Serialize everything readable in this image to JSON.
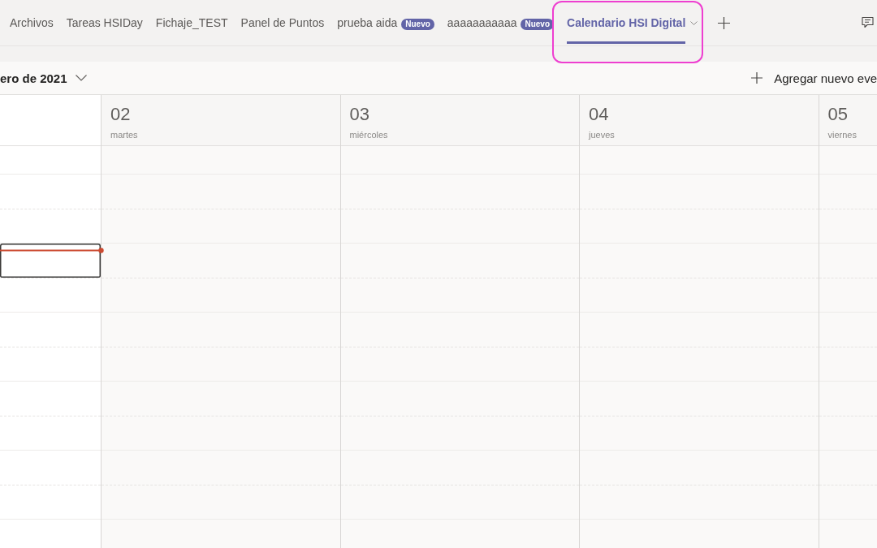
{
  "tab_bar": {
    "tabs": [
      {
        "label": "Archivos",
        "selected": false,
        "has_menu": false,
        "highlighted": false
      },
      {
        "label": "Tareas HSIDay",
        "selected": false,
        "has_menu": false,
        "highlighted": false
      },
      {
        "label": "Fichaje_TEST",
        "selected": false,
        "has_menu": false,
        "highlighted": false
      },
      {
        "label": "Panel de Puntos",
        "selected": false,
        "has_menu": false,
        "highlighted": false
      },
      {
        "label": "prueba aida",
        "badge": "Nuevo",
        "selected": false,
        "has_menu": false,
        "highlighted": false
      },
      {
        "label": "aaaaaaaaaaa",
        "badge": "Nuevo",
        "selected": false,
        "has_menu": false,
        "highlighted": false
      },
      {
        "label": "Calendario HSI Digital",
        "selected": true,
        "has_menu": true,
        "highlighted": true
      }
    ]
  },
  "toolbar": {
    "month": "ero de 2021",
    "add_event": "Agregar nuevo eve"
  },
  "calendar": {
    "days": [
      {
        "number": "02",
        "name": "martes"
      },
      {
        "number": "03",
        "name": "miércoles"
      },
      {
        "number": "04",
        "name": "jueves"
      },
      {
        "number": "05",
        "name": "viernes"
      }
    ],
    "time_slots": [
      {
        "selected": false,
        "now": false
      },
      {
        "selected": false,
        "now": false
      },
      {
        "selected": false,
        "now": false
      },
      {
        "selected": true,
        "now": true
      },
      {
        "selected": false,
        "now": false
      },
      {
        "selected": false,
        "now": false
      },
      {
        "selected": false,
        "now": false
      },
      {
        "selected": false,
        "now": false
      },
      {
        "selected": false,
        "now": false
      },
      {
        "selected": false,
        "now": false
      },
      {
        "selected": false,
        "now": false
      }
    ]
  }
}
